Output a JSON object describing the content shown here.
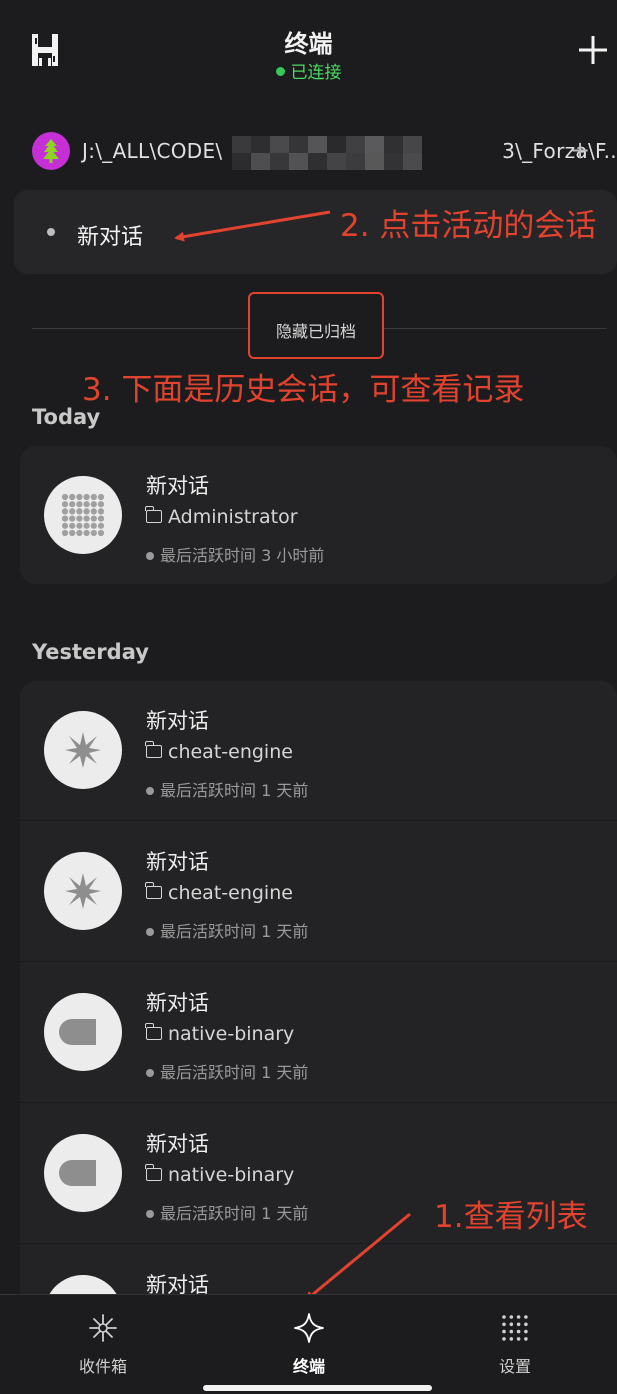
{
  "header": {
    "title": "终端",
    "status": "已连接"
  },
  "workspace": {
    "path": "J:\\_ALL\\CODE\\                                          3\\_Forza\\F...",
    "add": "+"
  },
  "active_session": {
    "title": "新对话"
  },
  "archive_toggle": "隐藏已归档",
  "annotations": {
    "step1": "1.查看列表",
    "step2": "2. 点击活动的会话",
    "step3": "3. 下面是历史会话，可查看记录"
  },
  "sections": {
    "today": {
      "label": "Today",
      "items": [
        {
          "title": "新对话",
          "folder": "Administrator",
          "time": "最后活跃时间 3 小时前",
          "icon": "grid-dots-icon"
        }
      ]
    },
    "yesterday": {
      "label": "Yesterday",
      "items": [
        {
          "title": "新对话",
          "folder": "cheat-engine",
          "time": "最后活跃时间 1 天前",
          "icon": "starburst-icon"
        },
        {
          "title": "新对话",
          "folder": "cheat-engine",
          "time": "最后活跃时间 1 天前",
          "icon": "starburst-icon"
        },
        {
          "title": "新对话",
          "folder": "native-binary",
          "time": "最后活跃时间 1 天前",
          "icon": "capsule-icon"
        },
        {
          "title": "新对话",
          "folder": "native-binary",
          "time": "最后活跃时间 1 天前",
          "icon": "capsule-icon"
        },
        {
          "title": "新对话",
          "icon": "capsule-icon"
        }
      ]
    }
  },
  "bottom_nav": [
    {
      "label": "收件箱",
      "icon": "sparkle-icon"
    },
    {
      "label": "终端",
      "icon": "four-point-star-icon",
      "active": true
    },
    {
      "label": "设置",
      "icon": "dot-grid-icon"
    }
  ],
  "colors": {
    "background": "#1c1c1e",
    "card": "#232325",
    "connected": "#4cd964",
    "annotation": "#e2432f",
    "avatar_purple": "#c62fd6",
    "avatar_green": "#8bd421"
  }
}
